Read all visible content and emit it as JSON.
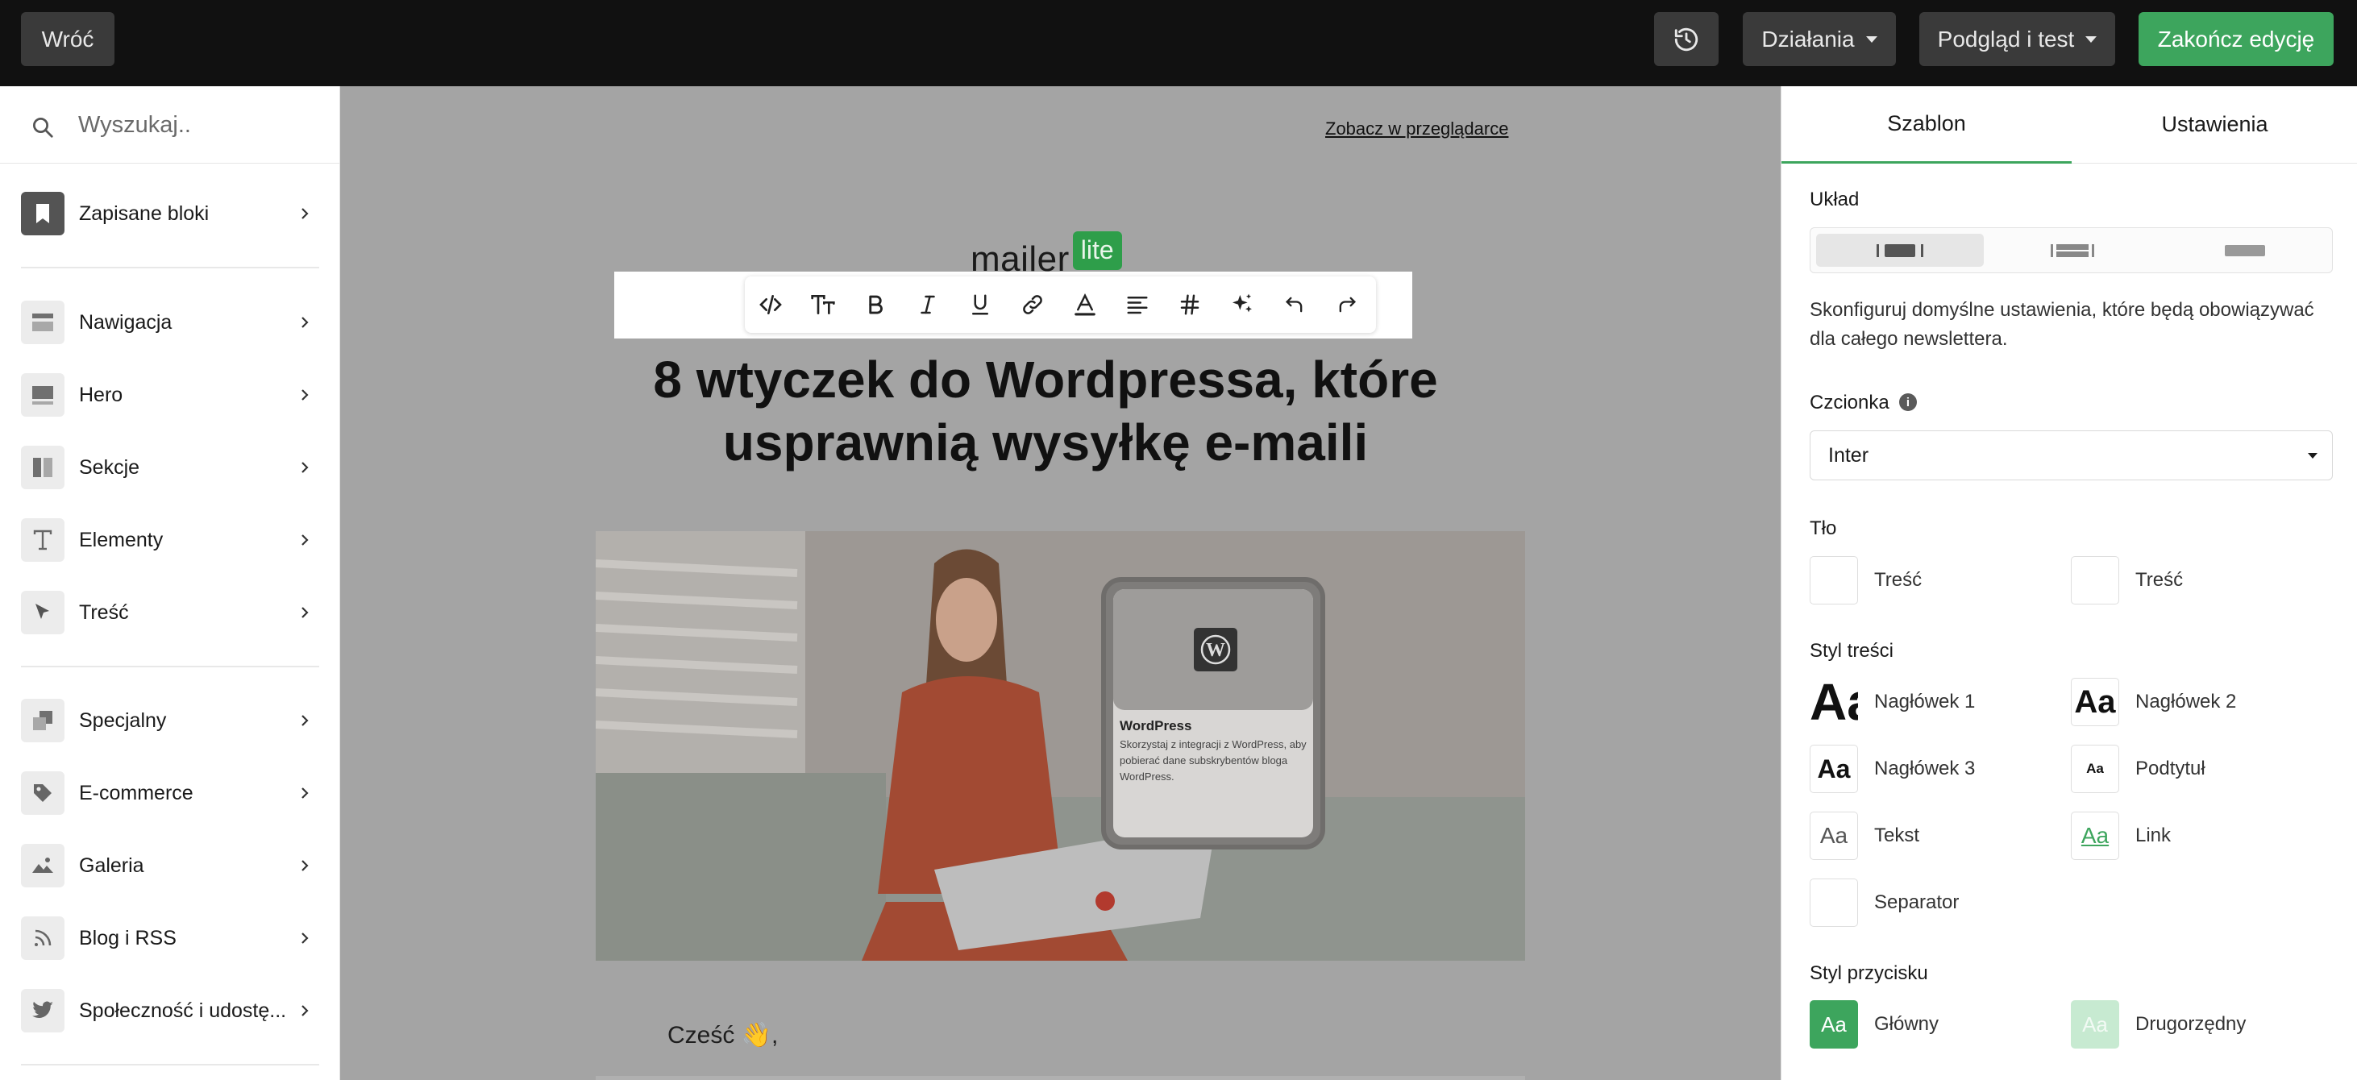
{
  "topbar": {
    "back_label": "Wróć",
    "actions_label": "Działania",
    "preview_label": "Podgląd i test",
    "finish_label": "Zakończ edycję"
  },
  "sidebar": {
    "search_placeholder": "Wyszukaj..",
    "items": [
      {
        "label": "Zapisane bloki",
        "icon": "bookmark-icon"
      },
      {
        "label": "Nawigacja",
        "icon": "navigation-block-icon"
      },
      {
        "label": "Hero",
        "icon": "hero-block-icon"
      },
      {
        "label": "Sekcje",
        "icon": "sections-block-icon"
      },
      {
        "label": "Elementy",
        "icon": "text-element-icon"
      },
      {
        "label": "Treść",
        "icon": "cursor-icon"
      },
      {
        "label": "Specjalny",
        "icon": "special-block-icon"
      },
      {
        "label": "E-commerce",
        "icon": "tag-icon"
      },
      {
        "label": "Galeria",
        "icon": "image-gallery-icon"
      },
      {
        "label": "Blog i RSS",
        "icon": "rss-icon"
      },
      {
        "label": "Społeczność i udostę...",
        "icon": "twitter-icon"
      }
    ]
  },
  "canvas": {
    "view_in_browser": "Zobacz w przeglądarce",
    "logo_text": "mailer",
    "logo_badge": "lite",
    "headline": "8 wtyczek do Wordpressa, które usprawnią wysyłkę e-maili",
    "card_title": "WordPress",
    "card_desc": "Skorzystaj z integracji z WordPress, aby pobierać dane subskrybentów bloga WordPress.",
    "greeting": "Cześć 👋,"
  },
  "panel": {
    "tab_template": "Szablon",
    "tab_settings": "Ustawienia",
    "layout_label": "Układ",
    "description": "Skonfiguruj domyślne ustawienia, które będą obowiązywać dla całego newslettera.",
    "font_label": "Czcionka",
    "font_value": "Inter",
    "background_label": "Tło",
    "bg_items": [
      "Treść",
      "Treść"
    ],
    "content_style_label": "Styl treści",
    "sample_glyph": "Aa",
    "styles": [
      "Nagłówek 1",
      "Nagłówek 2",
      "Nagłówek 3",
      "Podtytuł",
      "Tekst",
      "Link",
      "Separator"
    ],
    "button_style_label": "Styl przycisku",
    "buttons": [
      "Główny",
      "Drugorzędny"
    ]
  },
  "colors": {
    "accent": "#3da55d",
    "topbar": "#111111",
    "canvas_bg": "#a4a4a4"
  }
}
